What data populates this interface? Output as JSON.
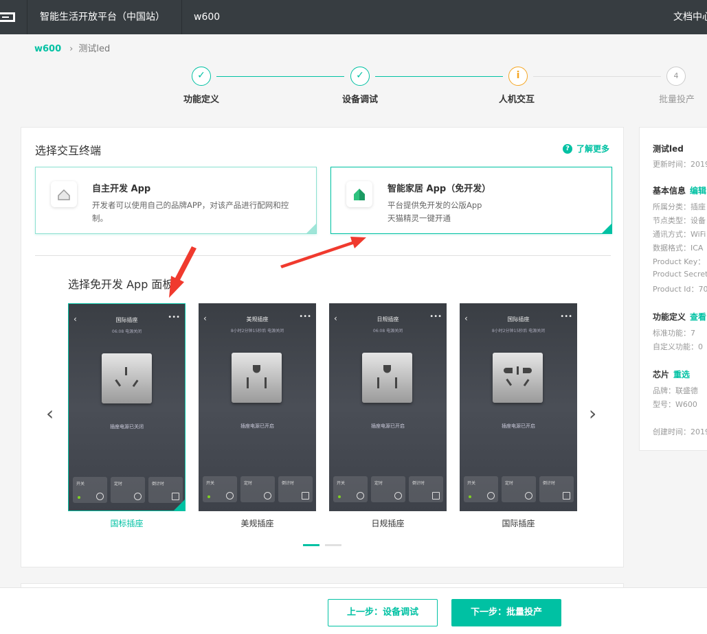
{
  "topbar": {
    "platform": "智能生活开放平台（中国站）",
    "product": "w600",
    "docs": "文档中心"
  },
  "breadcrumb": {
    "parent": "w600",
    "current": "测试led"
  },
  "steps": [
    {
      "label": "功能定义",
      "state": "done",
      "icon": "check-icon"
    },
    {
      "label": "设备调试",
      "state": "done",
      "icon": "check-icon"
    },
    {
      "label": "人机交互",
      "state": "current",
      "icon": "info-icon",
      "glyph": "i"
    },
    {
      "label": "批量投产",
      "state": "todo",
      "number": "4"
    }
  ],
  "terminal": {
    "title": "选择交互终端",
    "learn_more": "了解更多",
    "options": [
      {
        "title": "自主开发 App",
        "desc": "开发者可以使用自己的品牌APP，对该产品进行配网和控制。",
        "selected": false,
        "icon": "home-icon"
      },
      {
        "title": "智能家居 App（免开发）",
        "desc1": "平台提供免开发的公版App",
        "desc2": "天猫精灵一键开通",
        "selected": true,
        "icon": "smart-home-icon"
      }
    ]
  },
  "panel": {
    "title": "选择免开发 App 面板",
    "items": [
      {
        "label": "国标插座",
        "screen_title": "国际插座",
        "screen_sub": "06:08 电源关闭",
        "status": "插座电源已关闭",
        "selected": true
      },
      {
        "label": "美规插座",
        "screen_title": "美规插座",
        "screen_sub": "8小时2分钟15秒后 电源关闭",
        "status": "插座电源已开启",
        "selected": false
      },
      {
        "label": "日规插座",
        "screen_title": "日规插座",
        "screen_sub": "06:08 电源关闭",
        "status": "插座电源已开启",
        "selected": false
      },
      {
        "label": "国际插座",
        "screen_title": "国际插座",
        "screen_sub": "8小时2分钟15秒后 电源关闭",
        "status": "插座电源已开启",
        "selected": false
      }
    ],
    "controls": [
      "开关",
      "定时",
      "倒计时"
    ],
    "pages": 2,
    "active_page": 1
  },
  "sidebar": {
    "name": "测试led",
    "updated": "更新时间：2019",
    "basic_title": "基本信息",
    "basic_edit": "编辑",
    "category": "所属分类：插座",
    "node_type": "节点类型：设备",
    "comm": "通讯方式：WiFi",
    "data_format": "数据格式：ICA",
    "product_key": "Product Key：",
    "product_secret": "Product Secret",
    "product_id": "Product Id：70",
    "func_title": "功能定义",
    "func_link": "查看",
    "std_funcs": "标准功能：7",
    "custom_funcs": "自定义功能：0",
    "chip_title": "芯片",
    "chip_link": "重选",
    "brand": "品牌：联盛德",
    "model": "型号：W600",
    "created": "创建时间：2019"
  },
  "footer": {
    "prev": "上一步：设备调试",
    "next": "下一步：批量投产"
  },
  "colors": {
    "accent": "#00c1a3",
    "warn": "#f5a623",
    "topbar": "#373d41",
    "annotation": "#f03a2e"
  }
}
